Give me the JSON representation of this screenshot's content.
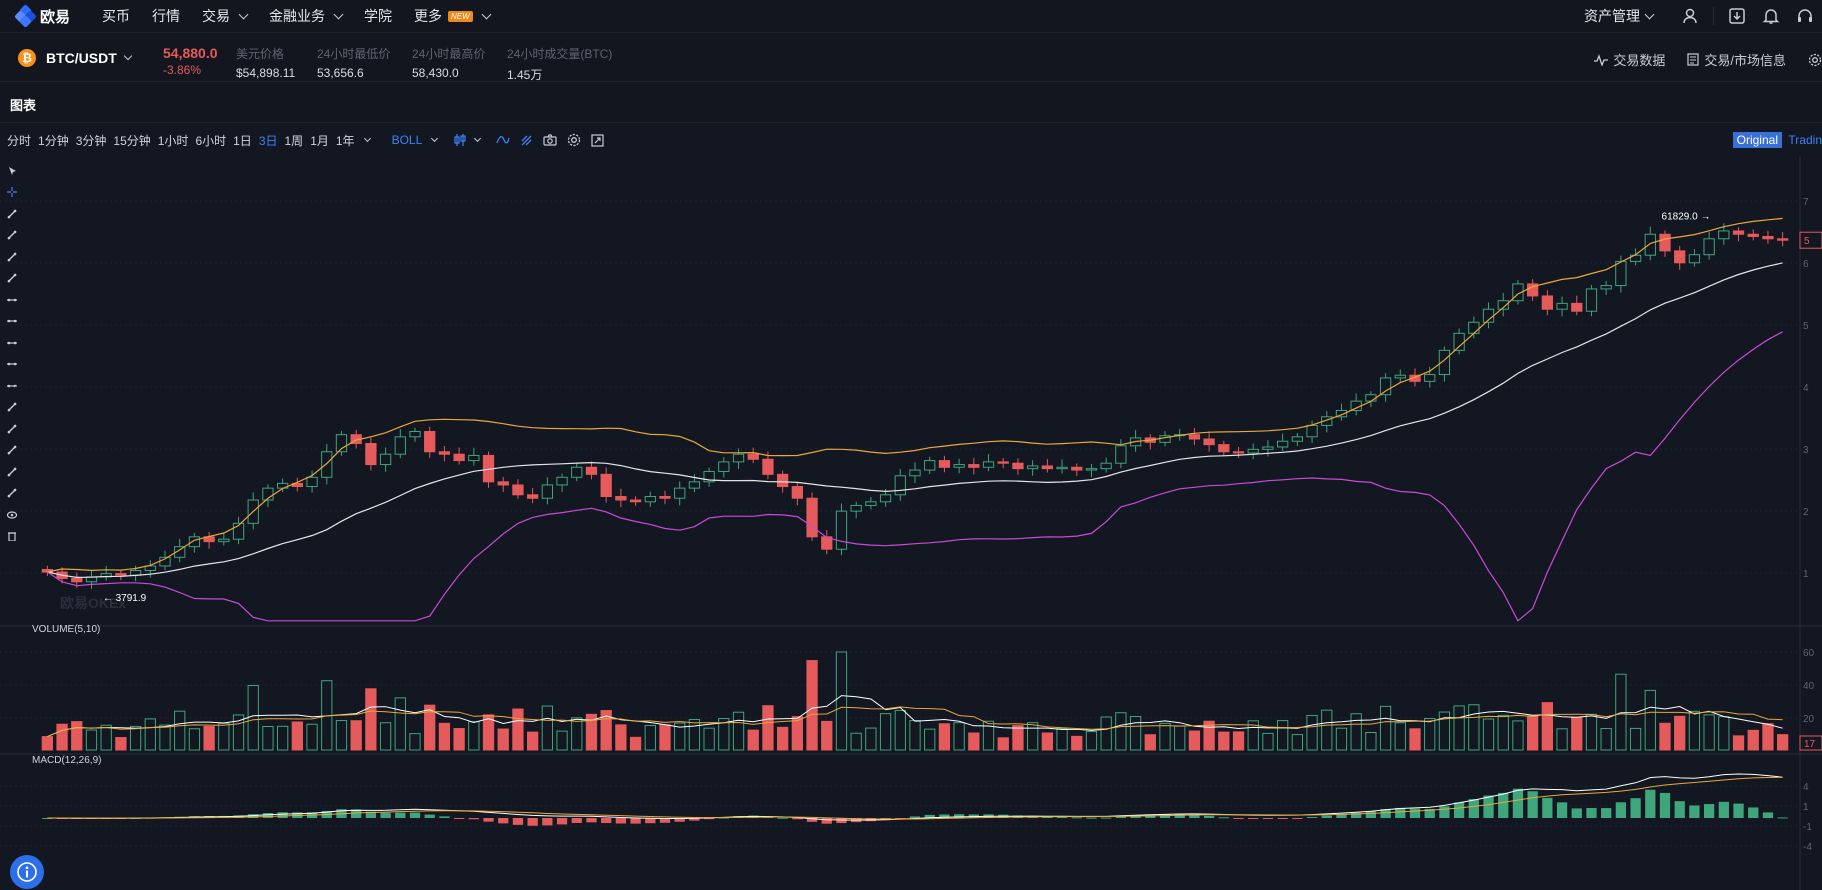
{
  "nav": {
    "logo_text": "欧易",
    "items": [
      {
        "label": "买币",
        "dropdown": false
      },
      {
        "label": "行情",
        "dropdown": false
      },
      {
        "label": "交易",
        "dropdown": true
      },
      {
        "label": "金融业务",
        "dropdown": true
      },
      {
        "label": "学院",
        "dropdown": false
      },
      {
        "label": "更多",
        "dropdown": true,
        "badge": "NEW"
      }
    ],
    "asset_label": "资产管理",
    "icons": [
      "user-icon",
      "download-icon",
      "bell-icon",
      "headset-icon"
    ]
  },
  "ticker": {
    "coin_glyph": "₿",
    "pair": "BTC/USDT",
    "last_price": "54,880.0",
    "change": "-3.86%",
    "stats": [
      {
        "label": "美元价格",
        "value": "$54,898.11"
      },
      {
        "label": "24小时最低价",
        "value": "53,656.6"
      },
      {
        "label": "24小时最高价",
        "value": "58,430.0"
      },
      {
        "label": "24小时成交量(BTC)",
        "value": "1.45万"
      }
    ],
    "right_links": [
      "交易数据",
      "交易/市场信息"
    ]
  },
  "chart_panel": {
    "title": "图表",
    "intervals": [
      "分时",
      "1分钟",
      "3分钟",
      "15分钟",
      "1小时",
      "6小时",
      "1日",
      "3日",
      "1周",
      "1月",
      "1年"
    ],
    "active_interval": "3日",
    "indicator": "BOLL",
    "view_original": "Original",
    "view_tradingview": "Tradin"
  },
  "colors": {
    "up": "#3fa57b",
    "down": "#e55a5a",
    "boll_upper": "#e8a93a",
    "boll_mid": "#e6e6e6",
    "boll_lower": "#c84bd6",
    "accent": "#3a82f7"
  },
  "chart_data": {
    "type": "candlestick",
    "symbol": "BTC/USDT",
    "interval": "3日",
    "watermark": "欧易OKEx",
    "annotations": {
      "high_label": "61829.0",
      "low_label": "3791.9"
    },
    "price_axis_ticks_visible": [
      "7",
      "6",
      "5",
      "4",
      "3",
      "2",
      "1"
    ],
    "last_price_tag": "5",
    "closes": [
      4100,
      3900,
      3800,
      3950,
      4050,
      4000,
      4150,
      4300,
      4600,
      5000,
      5400,
      5200,
      5300,
      6000,
      7200,
      7900,
      8200,
      8000,
      8600,
      10500,
      12000,
      11200,
      9500,
      10300,
      11800,
      12300,
      10500,
      10300,
      9800,
      10200,
      8300,
      8100,
      7500,
      7300,
      8100,
      8600,
      9300,
      8800,
      7400,
      7200,
      7100,
      7400,
      7300,
      7900,
      8300,
      9000,
      9700,
      10300,
      9900,
      8800,
      8000,
      7300,
      5400,
      4900,
      6600,
      6900,
      7100,
      7500,
      8700,
      9100,
      9800,
      9300,
      9500,
      9300,
      9700,
      9600,
      9200,
      9400,
      9200,
      9300,
      9100,
      9200,
      9600,
      11000,
      11700,
      11300,
      11900,
      12000,
      11600,
      11100,
      10500,
      10400,
      10700,
      10900,
      11400,
      11800,
      12900,
      13800,
      14500,
      15600,
      16400,
      18700,
      19100,
      18200,
      19200,
      23200,
      26500,
      28900,
      32000,
      34200,
      39000,
      35500,
      32000,
      33500,
      31500,
      37500,
      38500,
      46500,
      48800,
      57500,
      50500,
      46000,
      49000,
      55500,
      59000,
      57500,
      56500,
      55500,
      54880
    ],
    "boll_period_label": "BOLL",
    "volume": {
      "label": "VOLUME(5,10)",
      "axis_ticks_visible": [
        "60",
        "40",
        "20"
      ],
      "last_tag": "17"
    },
    "macd": {
      "label": "MACD(12,26,9)",
      "axis_ticks_visible": [
        "4",
        "1",
        "-1",
        "-4"
      ]
    }
  }
}
